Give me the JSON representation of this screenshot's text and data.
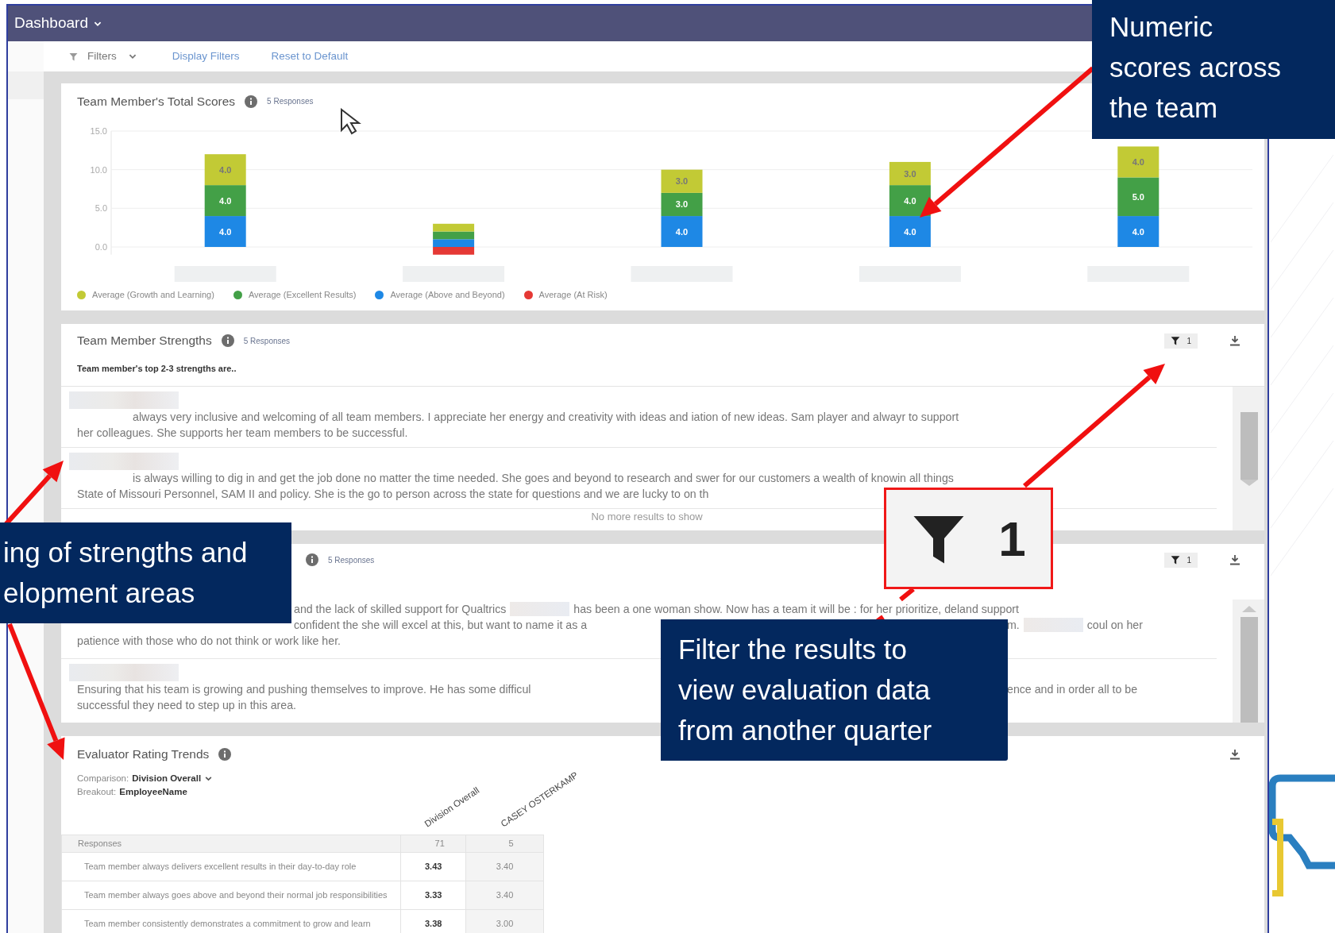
{
  "header": {
    "title": "Dashboard"
  },
  "filter_bar": {
    "filters_label": "Filters",
    "links": [
      "Display Filters",
      "Reset to Default"
    ]
  },
  "total_scores": {
    "title": "Team Member's Total Scores",
    "responses": "5 Responses",
    "chart_data": {
      "type": "bar",
      "stacked": true,
      "grid": true,
      "ylim": [
        -1,
        15
      ],
      "yticks": [
        {
          "value": 0,
          "label": "0.0"
        },
        {
          "value": 5,
          "label": "5.0"
        },
        {
          "value": 10,
          "label": "10.0"
        },
        {
          "value": 15,
          "label": "15.0"
        }
      ],
      "series": [
        {
          "name": "Average (Growth and Learning)",
          "color": "#c2ca35",
          "values": [
            4,
            1,
            3,
            3,
            4
          ],
          "value_labels": [
            "4.0",
            null,
            "3.0",
            "3.0",
            "4.0"
          ]
        },
        {
          "name": "Average (Excellent Results)",
          "color": "#43a047",
          "values": [
            4,
            1,
            3,
            4,
            5
          ],
          "value_labels": [
            "4.0",
            null,
            "3.0",
            "4.0",
            "5.0"
          ]
        },
        {
          "name": "Average (Above and Beyond)",
          "color": "#1e88e5",
          "values": [
            4,
            1,
            4,
            4,
            4
          ],
          "value_labels": [
            "4.0",
            null,
            "4.0",
            "4.0",
            "4.0"
          ]
        },
        {
          "name": "Average (At Risk)",
          "color": "#e53935",
          "values": [
            null,
            -1,
            null,
            null,
            null
          ]
        }
      ]
    }
  },
  "strengths": {
    "title": "Team Member Strengths",
    "responses": "5 Responses",
    "filter_count": "1",
    "question": "Team member's top 2-3 strengths are..",
    "answers": [
      {
        "name_blurred": true,
        "lines": [
          {
            "left": [
              {
                "kind": "text",
                "text": "always very inclusive and welcoming of all team members. I appreciate her energy and creativity with ideas and iation of new ideas. Sam player and alwayr to support"
              }
            ]
          },
          {
            "left": [
              {
                "kind": "text",
                "text": "her colleagues. She supports her team members to be successful."
              }
            ]
          }
        ]
      },
      {
        "name_blurred": true,
        "lines": [
          {
            "left": [
              {
                "kind": "text",
                "text": "is always willing to dig in and get the job done no matter the time needed. She goes and beyond to research and swer for our customers a wealth of knowin all things"
              }
            ]
          },
          {
            "left": [
              {
                "kind": "text",
                "text": "State of Missouri Personnel, SAM II and policy. She is the go to person across the state for questions and we are lucky to on th"
              }
            ]
          }
        ]
      }
    ],
    "end_note": "No more results to show"
  },
  "development": {
    "responses": "5 Responses",
    "filter_count": "1",
    "answers": [
      {
        "name_blurred": false,
        "lines": [
          {
            "left": [
              {
                "kind": "text",
                "text": "and the lack of skilled support for Qualtrics"
              },
              {
                "kind": "redaction"
              },
              {
                "kind": "text",
                "text": "has been a one woman show. Now has a team it will be : for her prioritize, deland support"
              }
            ]
          },
          {
            "left": [
              {
                "kind": "text",
                "text": "confident the she will excel at this, but want to name it as a"
              }
            ],
            "right": [
              {
                "kind": "text",
                "text": "m."
              },
              {
                "kind": "redaction"
              },
              {
                "kind": "text",
                "text": "coul on her"
              }
            ]
          },
          {
            "left": [
              {
                "kind": "text",
                "text": "patience with those who do not think or work like her."
              }
            ]
          }
        ]
      },
      {
        "name_blurred": true,
        "lines": [
          {
            "left": [
              {
                "kind": "text",
                "text": "Ensuring that his team is growing and pushing themselves to improve. He has some difficul"
              }
            ],
            "right": [
              {
                "kind": "text",
                "text": "ence and in order all to be"
              }
            ]
          },
          {
            "left": [
              {
                "kind": "text",
                "text": "successful they need to step up in this area."
              }
            ]
          }
        ]
      }
    ]
  },
  "rating_trends": {
    "title": "Evaluator Rating Trends",
    "comparison": {
      "label": "Comparison:",
      "value": "Division Overall"
    },
    "breakout": {
      "label": "Breakout:",
      "value": "EmployeeName"
    },
    "table": {
      "columns": [
        "",
        "Division Overall",
        "CASEY OSTERKAMP"
      ],
      "header_row": [
        "Responses",
        "71",
        "5"
      ],
      "rows": [
        [
          "Team member always delivers excellent results in their day-to-day role",
          "3.43",
          "3.40"
        ],
        [
          "Team member always goes above and beyond their normal job responsibilities",
          "3.33",
          "3.40"
        ],
        [
          "Team member consistently demonstrates a commitment to grow and learn",
          "3.38",
          "3.00"
        ]
      ]
    }
  },
  "callouts": [
    {
      "lines": [
        "Numeric",
        "scores across",
        "the team"
      ]
    },
    {
      "lines": [
        "ing of strengths and",
        "elopment areas"
      ]
    },
    {
      "lines": [
        "Filter the results to",
        "view evaluation data",
        "from another quarter"
      ]
    }
  ],
  "inset": {
    "count": "1"
  }
}
